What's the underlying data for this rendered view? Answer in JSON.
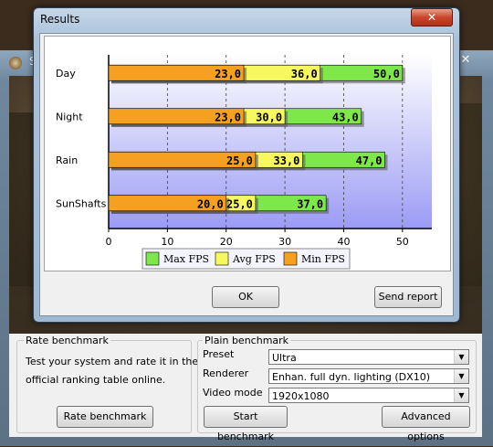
{
  "background_window": {
    "title_partial": "S",
    "close_glyph": "✕"
  },
  "dialog": {
    "title": "Results",
    "close_glyph": "✕"
  },
  "chart_data": {
    "type": "bar",
    "orientation": "horizontal",
    "stacked_overlay": true,
    "categories": [
      "Day",
      "Night",
      "Rain",
      "SunShafts"
    ],
    "series": [
      {
        "name": "Max FPS",
        "values": [
          50.0,
          43.0,
          47.0,
          37.0
        ],
        "labels": [
          "50,0",
          "43,0",
          "47,0",
          "37,0"
        ],
        "color": "#7ee84a"
      },
      {
        "name": "Avg FPS",
        "values": [
          36.0,
          30.0,
          33.0,
          25.0
        ],
        "labels": [
          "36,0",
          "30,0",
          "33,0",
          "25,0"
        ],
        "color": "#f7f760"
      },
      {
        "name": "Min FPS",
        "values": [
          23.0,
          23.0,
          25.0,
          20.0
        ],
        "labels": [
          "23,0",
          "23,0",
          "25,0",
          "20,0"
        ],
        "color": "#f5a020"
      }
    ],
    "xlim": [
      0,
      55
    ],
    "ticks": [
      "0",
      "10",
      "20",
      "30",
      "40",
      "50"
    ],
    "tick_values": [
      0,
      10,
      20,
      30,
      40,
      50
    ],
    "grid": true,
    "legend_position": "bottom",
    "plot_background": "gradient white-to-lavender"
  },
  "buttons": {
    "ok": "OK",
    "send_report": "Send report",
    "rate_benchmark": "Rate benchmark",
    "start_benchmark": "Start benchmark",
    "advanced_options": "Advanced options"
  },
  "rate_group": {
    "title": "Rate benchmark",
    "description_line1": "Test your system and rate it in the",
    "description_line2": "official ranking table online."
  },
  "plain_group": {
    "title": "Plain benchmark",
    "preset_label": "Preset",
    "preset_value": "Ultra",
    "renderer_label": "Renderer",
    "renderer_value": "Enhan. full dyn. lighting (DX10)",
    "video_mode_label": "Video mode",
    "video_mode_value": "1920x1080"
  }
}
